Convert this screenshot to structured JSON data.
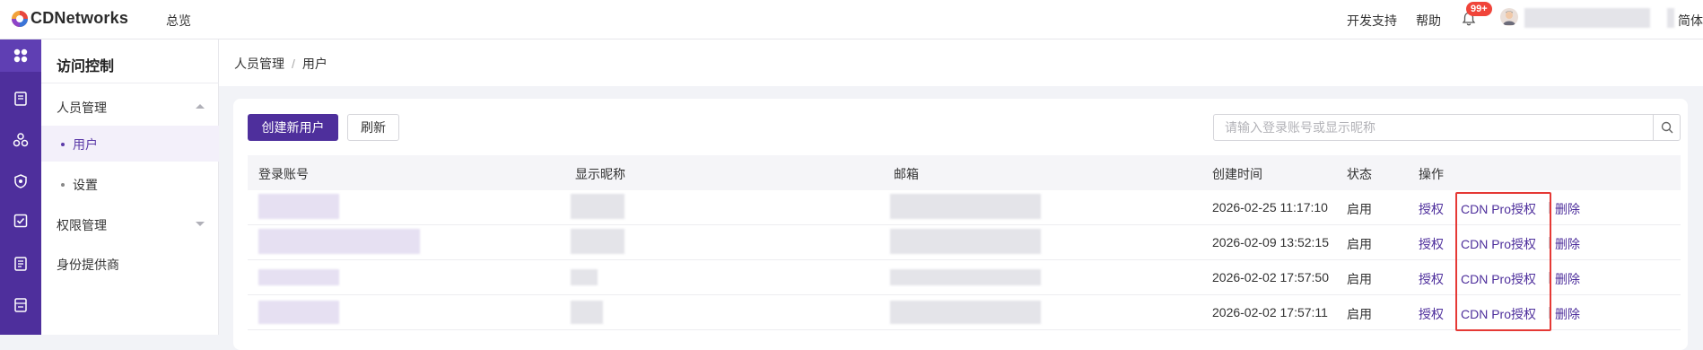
{
  "header": {
    "brand": "CDNetworks",
    "nav_overview": "总览",
    "dev_support": "开发支持",
    "help": "帮助",
    "notification_count": "99+",
    "language_partial": "简体"
  },
  "rail": {
    "icons": [
      "apps-icon",
      "document-icon",
      "network-icon",
      "shield-icon",
      "checklist-icon",
      "report-icon",
      "ticket-icon"
    ]
  },
  "sidebar": {
    "title": "访问控制",
    "groups": [
      {
        "label": "人员管理",
        "items": [
          "用户",
          "设置"
        ]
      },
      {
        "label": "权限管理"
      },
      {
        "label": "身份提供商"
      }
    ]
  },
  "breadcrumb": {
    "parent": "人员管理",
    "current": "用户"
  },
  "toolbar": {
    "create_label": "创建新用户",
    "refresh_label": "刷新",
    "search_placeholder": "请输入登录账号或显示昵称"
  },
  "table": {
    "columns": [
      "登录账号",
      "显示昵称",
      "邮箱",
      "创建时间",
      "状态",
      "操作"
    ],
    "rows": [
      {
        "created": "2026-02-25 11:17:10",
        "status": "启用"
      },
      {
        "created": "2026-02-09 13:52:15",
        "status": "启用"
      },
      {
        "created": "2026-02-02 17:57:50",
        "status": "启用"
      },
      {
        "created": "2026-02-02 17:57:11",
        "status": "启用"
      }
    ],
    "actions": {
      "grant": "授权",
      "cdn_pro_grant": "CDN Pro授权",
      "delete": "删除"
    }
  },
  "colors": {
    "brand_purple": "#4e2f9c",
    "highlight_red": "#e53935"
  }
}
